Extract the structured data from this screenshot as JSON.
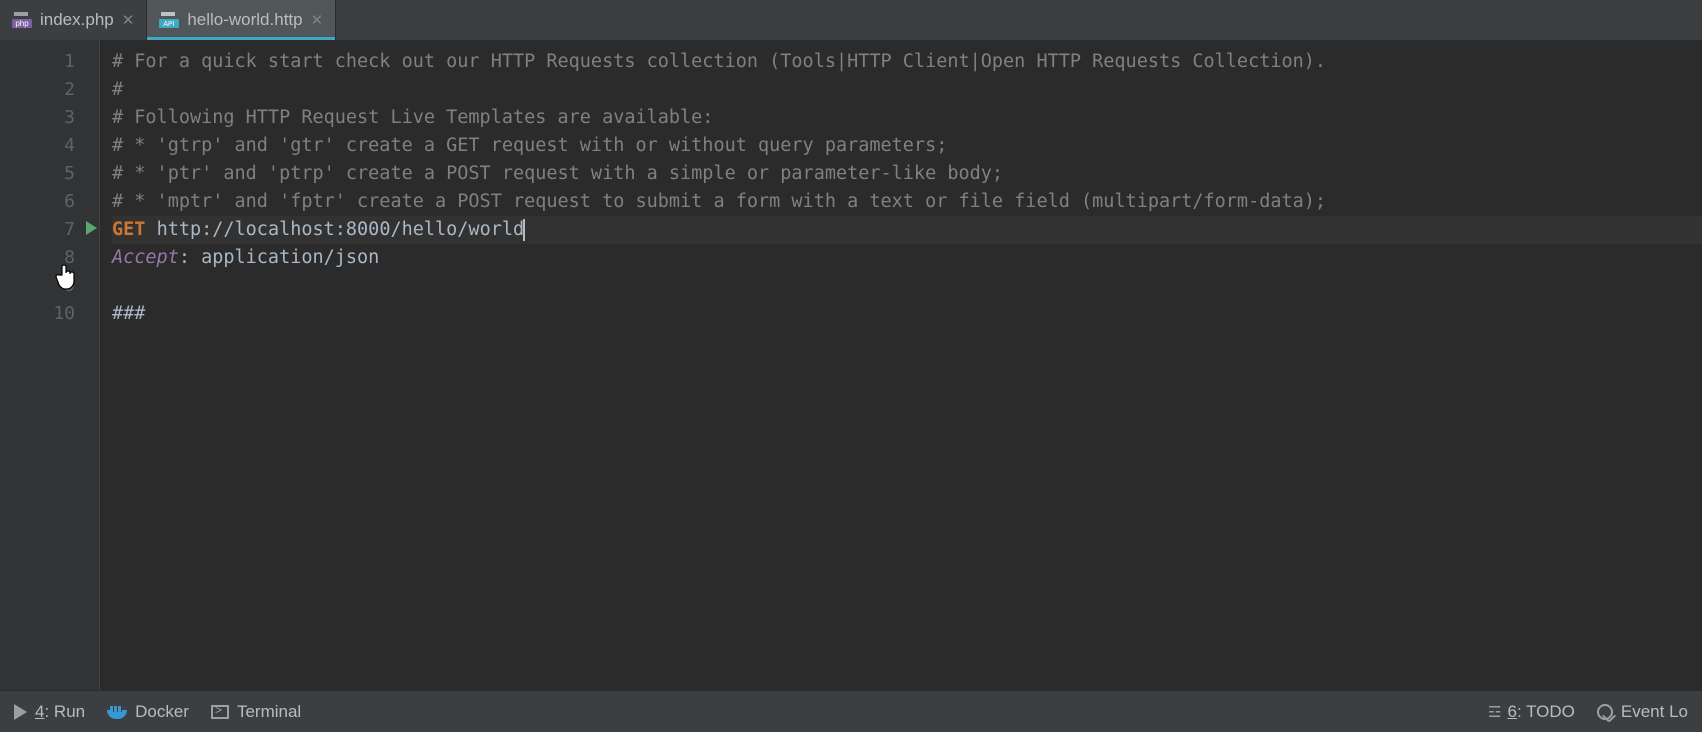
{
  "tabs": [
    {
      "label": "index.php",
      "icon": "php",
      "active": false
    },
    {
      "label": "hello-world.http",
      "icon": "api",
      "active": true
    }
  ],
  "code": {
    "lines": [
      {
        "n": "1",
        "type": "comment",
        "text": "# For a quick start check out our HTTP Requests collection (Tools|HTTP Client|Open HTTP Requests Collection)."
      },
      {
        "n": "2",
        "type": "comment",
        "text": "#"
      },
      {
        "n": "3",
        "type": "comment",
        "text": "# Following HTTP Request Live Templates are available:"
      },
      {
        "n": "4",
        "type": "comment",
        "text": "# * 'gtrp' and 'gtr' create a GET request with or without query parameters;"
      },
      {
        "n": "5",
        "type": "comment",
        "text": "# * 'ptr' and 'ptrp' create a POST request with a simple or parameter-like body;"
      },
      {
        "n": "6",
        "type": "comment-bulb",
        "text": "# * 'mptr' and 'fptr' create a POST request to submit a form with a text or file field (multipart/form-data);"
      },
      {
        "n": "7",
        "type": "request",
        "method": "GET",
        "url": "http://localhost:8000/hello/world",
        "run": true,
        "current": true
      },
      {
        "n": "8",
        "type": "header",
        "name": "Accept",
        "value": "application/json"
      },
      {
        "n": "9",
        "type": "blank",
        "text": ""
      },
      {
        "n": "10",
        "type": "sep",
        "text": "###"
      }
    ]
  },
  "status": {
    "run": {
      "key": "4",
      "label": ": Run"
    },
    "docker": {
      "label": "Docker"
    },
    "terminal": {
      "label": "Terminal"
    },
    "todo": {
      "key": "6",
      "label": ": TODO"
    },
    "eventlog": {
      "label": "Event Lo"
    }
  }
}
